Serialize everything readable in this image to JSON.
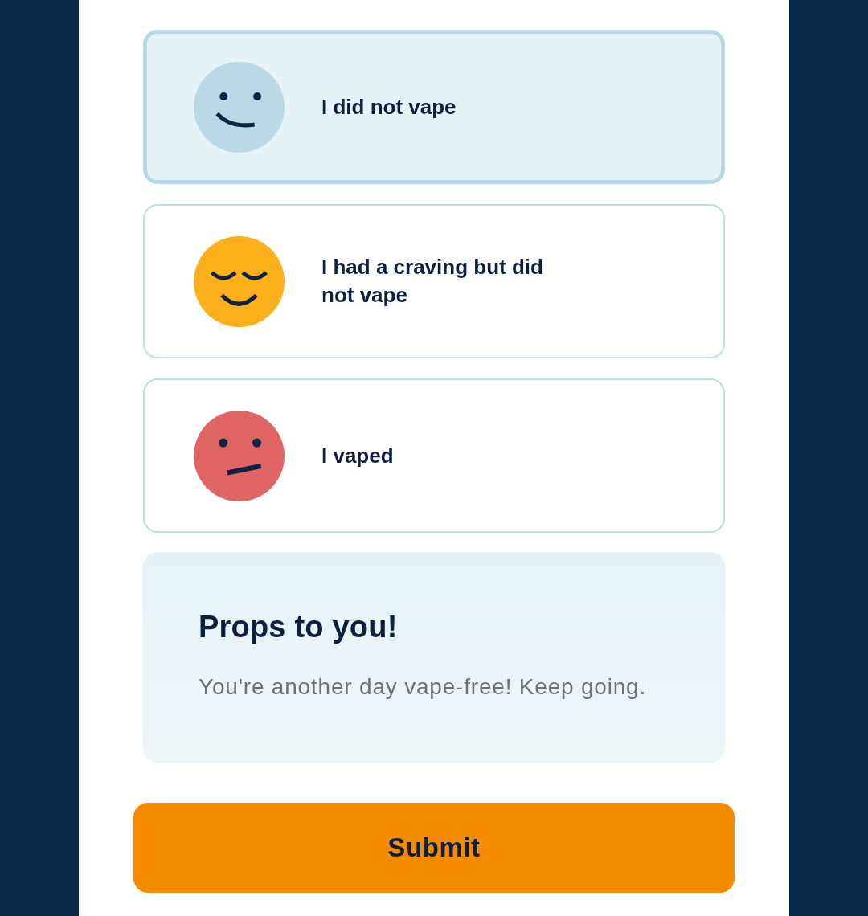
{
  "options": [
    {
      "label": "I did not vape",
      "kind": "happy",
      "color": "#b9dae5",
      "selected": true
    },
    {
      "label": "I had a craving but did not vape",
      "kind": "calm",
      "color": "#fbaf1b",
      "selected": false
    },
    {
      "label": "I vaped",
      "kind": "neutral",
      "color": "#e06464",
      "selected": false
    }
  ],
  "feedback": {
    "title": "Props to you!",
    "message": "You're another day vape-free! Keep going."
  },
  "submit": {
    "label": "Submit"
  }
}
